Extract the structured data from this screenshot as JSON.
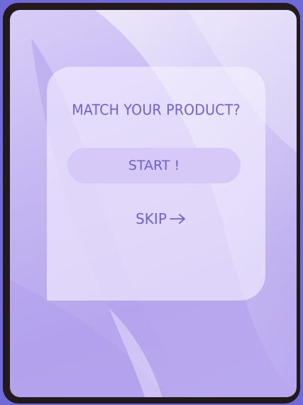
{
  "quiz": {
    "question": "MATCH YOUR PRODUCT?",
    "start_label": "START !",
    "skip_label": "SKIP"
  },
  "icons": {
    "skip_arrow": "arrow-right-icon"
  },
  "colors": {
    "page_background": "#6f6ad8",
    "frame": "#231a1e",
    "accent_text": "#6c62d4",
    "button_fill": "#d6c9f7",
    "card_fill": "#f6f0ff"
  }
}
